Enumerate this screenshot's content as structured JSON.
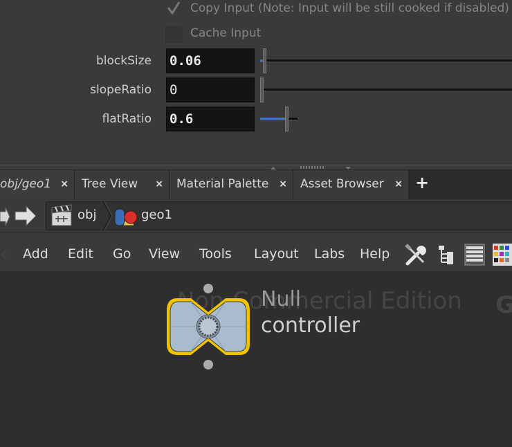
{
  "params": {
    "copy_input_label": "Copy Input (Note: Input will be still cooked if disabled)",
    "cache_input_label": "Cache Input",
    "block_size": {
      "label": "blockSize",
      "value": "0.06",
      "slider_fraction": 0.06
    },
    "slope_ratio": {
      "label": "slopeRatio",
      "value": "0",
      "slider_fraction": 0.0
    },
    "flat_ratio": {
      "label": "flatRatio",
      "value": "0.6",
      "slider_fraction": 0.6
    }
  },
  "tabs": [
    {
      "label": "obj/geo1",
      "close": "×"
    },
    {
      "label": "Tree View",
      "close": "×"
    },
    {
      "label": "Material Palette",
      "close": "×"
    },
    {
      "label": "Asset Browser",
      "close": "×"
    }
  ],
  "add_tab_label": "+",
  "path": {
    "crumbs": [
      {
        "label": "obj",
        "icon": "obj-context-icon"
      },
      {
        "label": "geo1",
        "icon": "geometry-icon"
      }
    ]
  },
  "menu": {
    "items": [
      "Add",
      "Edit",
      "Go",
      "View",
      "Tools",
      "Layout",
      "Labs",
      "Help"
    ]
  },
  "network": {
    "watermark": "Non-Commercial Edition",
    "watermark_right": "G",
    "node": {
      "type": "Null",
      "name": "controller",
      "outline_color": "#f0c400",
      "fill_color": "#a9bccd"
    }
  },
  "colors": {
    "accent": "#3f76c4",
    "background": "#3a3a3a",
    "network_bg": "#2e2e2e"
  }
}
